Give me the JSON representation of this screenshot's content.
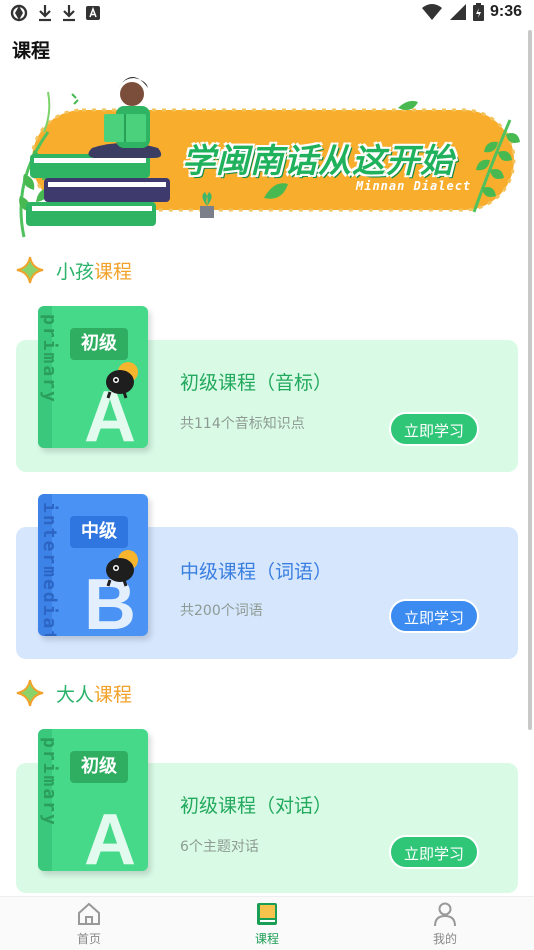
{
  "status_bar": {
    "time": "9:36"
  },
  "header": {
    "title": "课程"
  },
  "banner": {
    "title": "学闽南话从这开始",
    "subtitle": "Minnan Dialect"
  },
  "sections": [
    {
      "label_a": "小孩",
      "label_b": "课程"
    },
    {
      "label_a": "大人",
      "label_b": "课程"
    }
  ],
  "courses": [
    {
      "book_level": "初级",
      "book_spine": "primary",
      "book_letter": "A",
      "title": "初级课程（音标）",
      "subtitle": "共114个音标知识点",
      "button": "立即学习"
    },
    {
      "book_level": "中级",
      "book_spine": "intermediate",
      "book_letter": "B",
      "title": "中级课程（词语）",
      "subtitle": "共200个词语",
      "button": "立即学习"
    },
    {
      "book_level": "初级",
      "book_spine": "primary",
      "book_letter": "A",
      "title": "初级课程（对话）",
      "subtitle": "6个主题对话",
      "button": "立即学习"
    }
  ],
  "tabs": [
    {
      "label": "首页",
      "icon": "home-icon"
    },
    {
      "label": "课程",
      "icon": "book-icon"
    },
    {
      "label": "我的",
      "icon": "person-icon"
    }
  ],
  "colors": {
    "accent_green": "#2bb36a",
    "accent_orange": "#f2a22a",
    "blue": "#3c8bf0",
    "banner_orange": "#f9ad2c"
  }
}
